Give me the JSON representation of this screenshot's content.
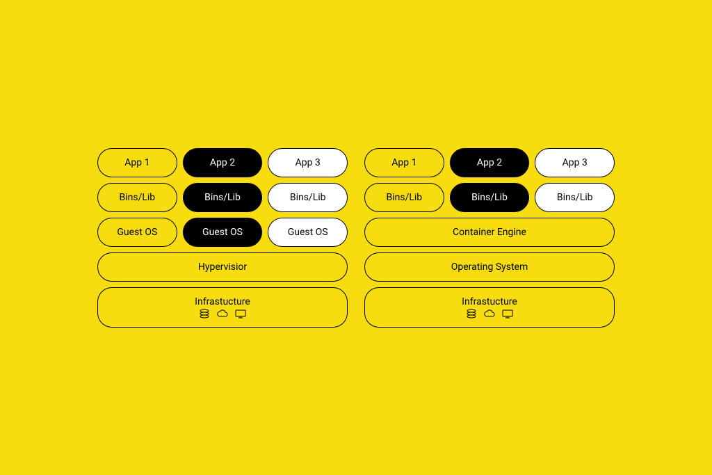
{
  "colors": {
    "background": "#F7DC0F",
    "black": "#000000",
    "white": "#FFFFFF"
  },
  "left_stack": {
    "rows": [
      [
        {
          "label": "App 1",
          "style": "yellow"
        },
        {
          "label": "App 2",
          "style": "black"
        },
        {
          "label": "App 3",
          "style": "white"
        }
      ],
      [
        {
          "label": "Bins/Lib",
          "style": "yellow"
        },
        {
          "label": "Bins/Lib",
          "style": "black"
        },
        {
          "label": "Bins/Lib",
          "style": "white"
        }
      ],
      [
        {
          "label": "Guest OS",
          "style": "yellow"
        },
        {
          "label": "Guest OS",
          "style": "black"
        },
        {
          "label": "Guest OS",
          "style": "white"
        }
      ]
    ],
    "wide_rows": [
      {
        "label": "Hypervisior"
      },
      {
        "label": "Infrastucture",
        "has_icons": true
      }
    ]
  },
  "right_stack": {
    "rows": [
      [
        {
          "label": "App 1",
          "style": "yellow"
        },
        {
          "label": "App 2",
          "style": "black"
        },
        {
          "label": "App 3",
          "style": "white"
        }
      ],
      [
        {
          "label": "Bins/Lib",
          "style": "yellow"
        },
        {
          "label": "Bins/Lib",
          "style": "black"
        },
        {
          "label": "Bins/Lib",
          "style": "white"
        }
      ]
    ],
    "wide_rows": [
      {
        "label": "Container Engine"
      },
      {
        "label": "Operating System"
      },
      {
        "label": "Infrastucture",
        "has_icons": true
      }
    ]
  },
  "icons": [
    "database",
    "cloud",
    "monitor"
  ]
}
